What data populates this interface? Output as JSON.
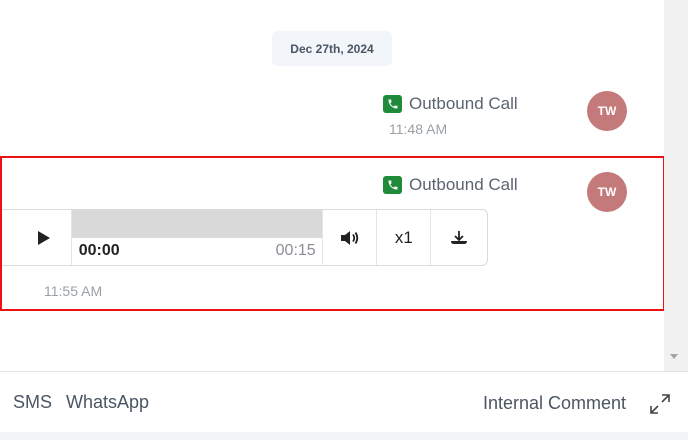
{
  "conversation": {
    "date_separator": "Dec 27th, 2024",
    "messages": [
      {
        "title": "Outbound Call",
        "time": "11:48 AM",
        "avatar_initials": "TW",
        "icon": "phone-icon"
      },
      {
        "title": "Outbound Call",
        "time": "11:55 AM",
        "avatar_initials": "TW",
        "icon": "phone-icon",
        "recording": {
          "current_time": "00:00",
          "duration": "00:15",
          "speed": "x1",
          "progress_fraction": 0
        }
      }
    ]
  },
  "composer": {
    "tabs": [
      "SMS",
      "WhatsApp"
    ],
    "internal_comment": "Internal Comment",
    "expand_icon": "expand-icon"
  },
  "colors": {
    "phone_badge": "#1f8a3a",
    "avatar": "#c47a7a",
    "highlight_border": "#ee1111"
  }
}
